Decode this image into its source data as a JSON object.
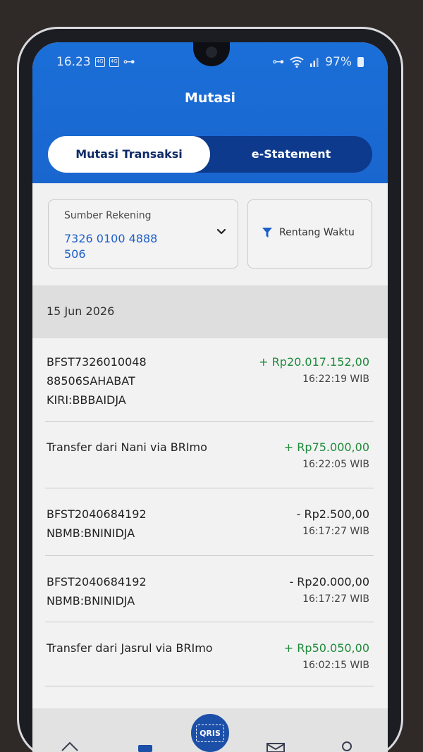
{
  "status_bar": {
    "time": "16.23",
    "sim1": "4G",
    "sim2": "4G",
    "battery": "97%"
  },
  "header": {
    "title": "Mutasi"
  },
  "tabs": [
    {
      "label": "Mutasi Transaksi",
      "active": true
    },
    {
      "label": "e-Statement",
      "active": false
    }
  ],
  "filters": {
    "source_label": "Sumber Rekening",
    "source_value": "7326 0100 4888 506",
    "range_label": "Rentang Waktu"
  },
  "date_group": "15 Jun 2026",
  "transactions": [
    {
      "description": "BFST7326010048\n88506SAHABAT\nKIRI:BBBAIDJA",
      "amount": "+ Rp20.017.152,00",
      "type": "credit",
      "time": "16:22:19 WIB"
    },
    {
      "description": "Transfer dari Nani via BRImo",
      "amount": "+ Rp75.000,00",
      "type": "credit",
      "time": "16:22:05 WIB"
    },
    {
      "description": "BFST2040684192\nNBMB:BNINIDJA",
      "amount": "- Rp2.500,00",
      "type": "debit",
      "time": "16:17:27 WIB"
    },
    {
      "description": "BFST2040684192\nNBMB:BNINIDJA",
      "amount": "- Rp20.000,00",
      "type": "debit",
      "time": "16:17:27 WIB"
    },
    {
      "description": "Transfer dari Jasrul via BRImo",
      "amount": "+ Rp50.050,00",
      "type": "credit",
      "time": "16:02:15 WIB"
    }
  ],
  "bottom_nav": {
    "qris_label": "QRIS"
  },
  "colors": {
    "brand_blue": "#1b6fd8",
    "credit_green": "#1e8a3a",
    "tab_dark": "#0d3a8c"
  }
}
